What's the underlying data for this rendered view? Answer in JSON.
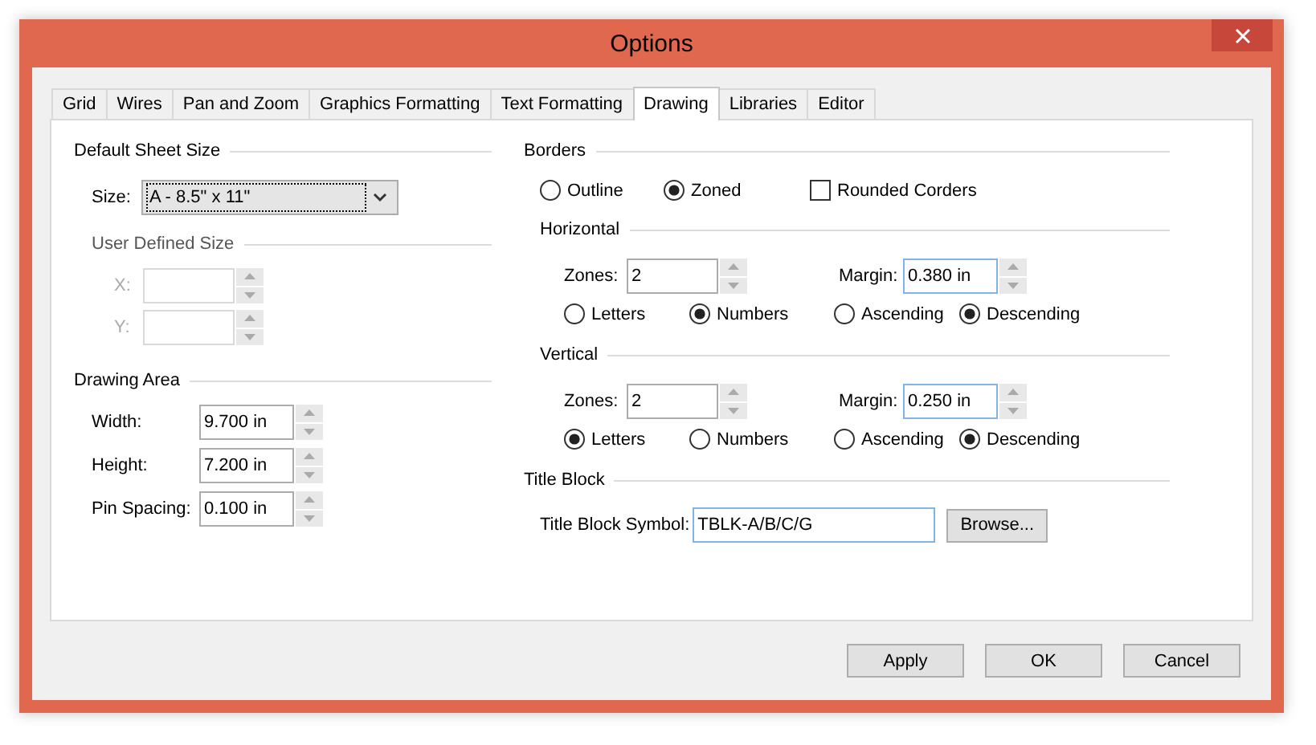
{
  "window": {
    "title": "Options"
  },
  "tabs": [
    {
      "label": "Grid",
      "selected": false
    },
    {
      "label": "Wires",
      "selected": false
    },
    {
      "label": "Pan and Zoom",
      "selected": false
    },
    {
      "label": "Graphics Formatting",
      "selected": false
    },
    {
      "label": "Text Formatting",
      "selected": false
    },
    {
      "label": "Drawing",
      "selected": true
    },
    {
      "label": "Libraries",
      "selected": false
    },
    {
      "label": "Editor",
      "selected": false
    }
  ],
  "default_sheet_size": {
    "title": "Default Sheet Size",
    "size": {
      "label": "Size:",
      "value": "A - 8.5\" x 11\"",
      "focused": true
    }
  },
  "user_defined_size": {
    "title": "User Defined Size",
    "disabled": true,
    "fields": [
      {
        "label": "X:"
      },
      {
        "label": "Y:"
      }
    ]
  },
  "drawing_area": {
    "title": "Drawing Area",
    "fields": [
      {
        "label": "Width:",
        "value": "9.700 in"
      },
      {
        "label": "Height:",
        "value": "7.200 in"
      },
      {
        "label": "Pin Spacing:",
        "value": "0.100 in"
      }
    ]
  },
  "borders": {
    "title": "Borders",
    "options": [
      {
        "kind": "radio",
        "label": "Outline",
        "selected": false
      },
      {
        "kind": "radio",
        "label": "Zoned",
        "selected": true
      },
      {
        "kind": "checkbox",
        "label": "Rounded Corders",
        "checked": false
      }
    ]
  },
  "horizontal": {
    "title": "Horizontal",
    "zones": {
      "label": "Zones:",
      "value": "2"
    },
    "margin": {
      "label": "Margin:",
      "value": "0.380 in",
      "highlighted": true
    },
    "labeling": [
      {
        "label": "Letters",
        "selected": false
      },
      {
        "label": "Numbers",
        "selected": true
      }
    ],
    "order": [
      {
        "label": "Ascending",
        "selected": false
      },
      {
        "label": "Descending",
        "selected": true
      }
    ]
  },
  "vertical": {
    "title": "Vertical",
    "zones": {
      "label": "Zones:",
      "value": "2"
    },
    "margin": {
      "label": "Margin:",
      "value": "0.250 in",
      "highlighted": true
    },
    "labeling": [
      {
        "label": "Letters",
        "selected": true
      },
      {
        "label": "Numbers",
        "selected": false
      }
    ],
    "order": [
      {
        "label": "Ascending",
        "selected": false
      },
      {
        "label": "Descending",
        "selected": true
      }
    ]
  },
  "title_block": {
    "title": "Title Block",
    "symbol": {
      "label": "Title Block Symbol:",
      "value": "TBLK-A/B/C/G",
      "highlighted": true
    },
    "browse_button": "Browse..."
  },
  "buttons": [
    "Apply",
    "OK",
    "Cancel"
  ]
}
